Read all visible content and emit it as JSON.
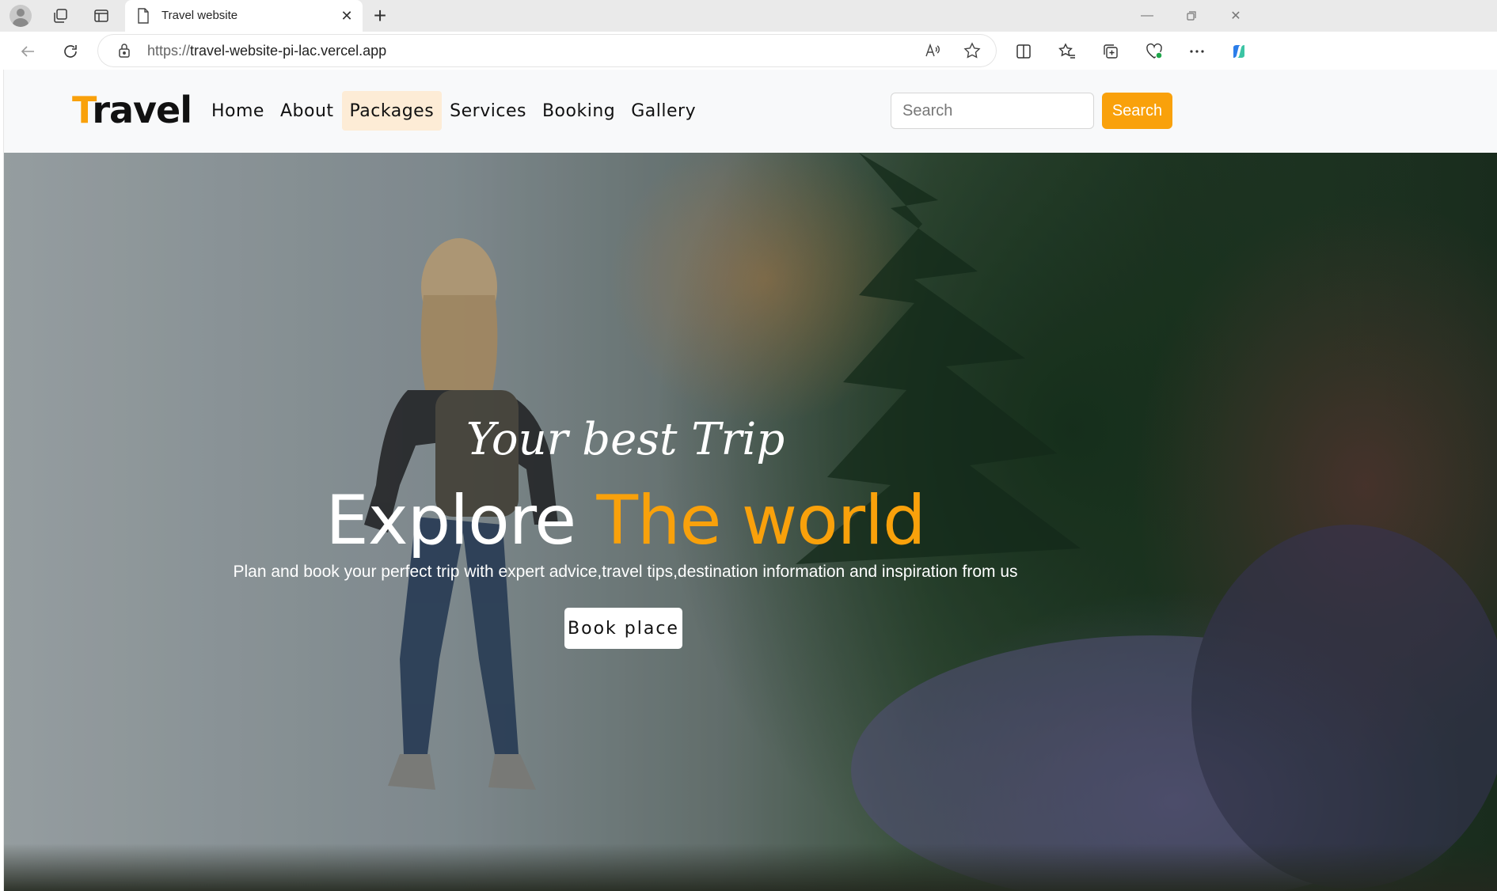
{
  "browser": {
    "tab_title": "Travel website",
    "url_scheme": "https://",
    "url_host": "travel-website-pi-lac.vercel.app",
    "icons": [
      "profile-avatar",
      "workspaces-icon",
      "tab-actions-icon",
      "page-icon",
      "close-icon",
      "new-tab-icon",
      "minimize-icon",
      "restore-icon",
      "window-close-icon",
      "back-icon",
      "refresh-icon",
      "lock-icon",
      "read-aloud-icon",
      "favorite-star-icon",
      "split-screen-icon",
      "favorites-icon",
      "collections-icon",
      "browser-essentials-icon",
      "more-icon",
      "copilot-icon"
    ]
  },
  "site": {
    "logo": {
      "first": "T",
      "rest": "ravel"
    },
    "menu": [
      {
        "label": "Home",
        "active": false
      },
      {
        "label": "About",
        "active": false
      },
      {
        "label": "Packages",
        "active": true
      },
      {
        "label": "Services",
        "active": false
      },
      {
        "label": "Booking",
        "active": false
      },
      {
        "label": "Gallery",
        "active": false
      }
    ],
    "search": {
      "placeholder": "Search",
      "button": "Search"
    },
    "accent_color": "#f9a10b"
  },
  "hero": {
    "subtitle": "Your best Trip",
    "headline_white": "Explore ",
    "headline_accent": "The world",
    "tagline": "Plan and book your perfect trip with expert advice,travel tips,destination information and inspiration from us",
    "cta": "Book place"
  }
}
